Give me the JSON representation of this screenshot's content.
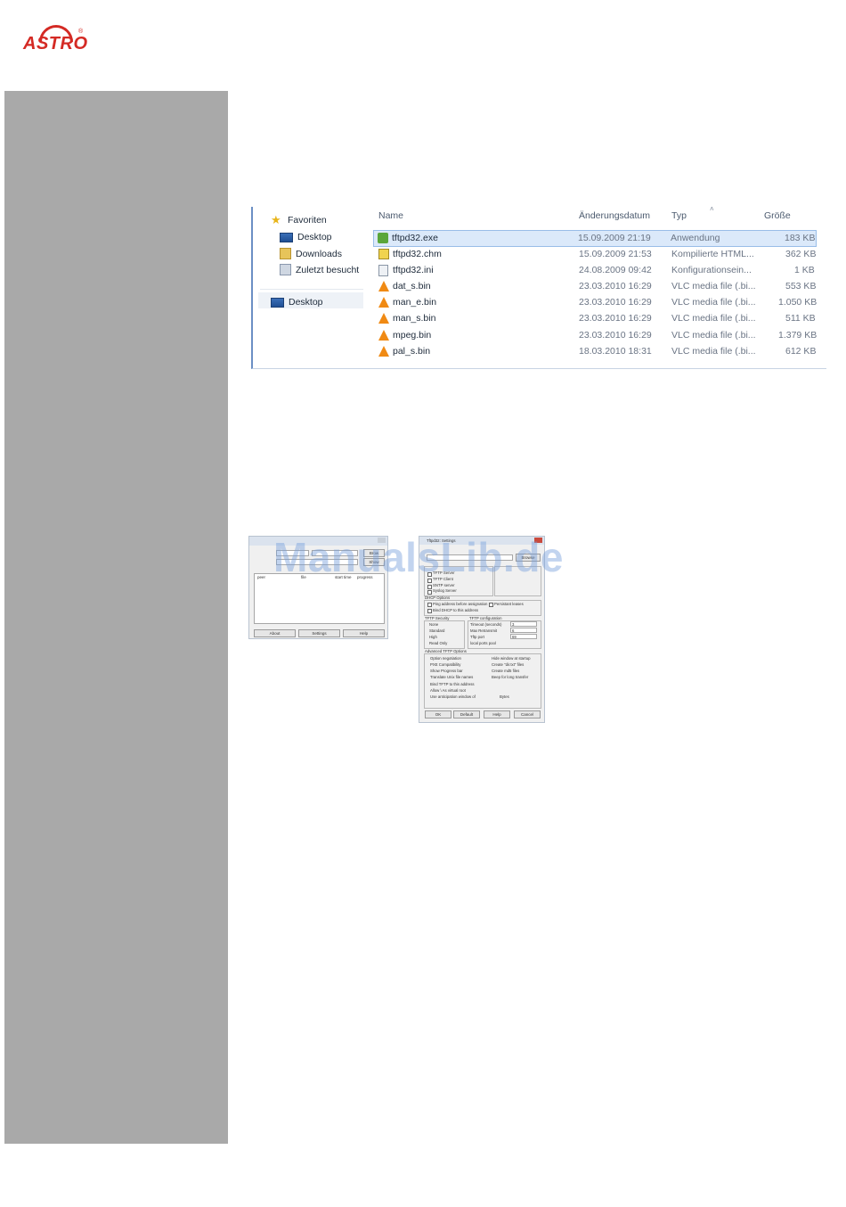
{
  "brand": {
    "logo": "ASTRO",
    "registered": "®",
    "color": "#d42a24"
  },
  "explorer": {
    "nav": [
      {
        "label": "Favoriten",
        "icon": "star-icon"
      },
      {
        "label": "Desktop",
        "icon": "desktop-icon"
      },
      {
        "label": "Downloads",
        "icon": "downloads-folder-icon"
      },
      {
        "label": "Zuletzt besucht",
        "icon": "recent-places-icon"
      },
      {
        "label": "Desktop",
        "icon": "desktop-icon"
      }
    ],
    "columns": [
      "Name",
      "Änderungsdatum",
      "Typ",
      "Größe"
    ],
    "files": [
      {
        "name": "tftpd32.exe",
        "date": "15.09.2009 21:19",
        "type": "Anwendung",
        "size": "183 KB",
        "icon": "exe-icon"
      },
      {
        "name": "tftpd32.chm",
        "date": "15.09.2009 21:53",
        "type": "Kompilierte HTML...",
        "size": "362 KB",
        "icon": "chm-icon"
      },
      {
        "name": "tftpd32.ini",
        "date": "24.08.2009 09:42",
        "type": "Konfigurationsein...",
        "size": "1 KB",
        "icon": "ini-icon"
      },
      {
        "name": "dat_s.bin",
        "date": "23.03.2010 16:29",
        "type": "VLC media file (.bi...",
        "size": "553 KB",
        "icon": "vlc-icon"
      },
      {
        "name": "man_e.bin",
        "date": "23.03.2010 16:29",
        "type": "VLC media file (.bi...",
        "size": "1.050 KB",
        "icon": "vlc-icon"
      },
      {
        "name": "man_s.bin",
        "date": "23.03.2010 16:29",
        "type": "VLC media file (.bi...",
        "size": "511 KB",
        "icon": "vlc-icon"
      },
      {
        "name": "mpeg.bin",
        "date": "23.03.2010 16:29",
        "type": "VLC media file (.bi...",
        "size": "1.379 KB",
        "icon": "vlc-icon"
      },
      {
        "name": "pal_s.bin",
        "date": "18.03.2010 18:31",
        "type": "VLC media file (.bi...",
        "size": "612 KB",
        "icon": "vlc-icon"
      }
    ]
  },
  "tftp_main": {
    "buttons": [
      "About",
      "Settings",
      "Help"
    ],
    "top_buttons": [
      "Brow",
      "Show"
    ],
    "list_columns": [
      "peer",
      "file",
      "start time",
      "progress"
    ]
  },
  "tftp_settings": {
    "title": "Tftpd32: Settings",
    "browse": "Browse",
    "groups": [
      "DHCP Options",
      "TFTP Security",
      "TFTP configuration",
      "Advanced TFTP Options"
    ],
    "services": [
      "TFTP Server",
      "TFTP Client",
      "SNTP server",
      "Syslog Server"
    ],
    "dhcp_options": [
      "Ping address before assignation",
      "Persistant leases",
      "Bind DHCP to this address"
    ],
    "security": [
      "None",
      "Standard",
      "High",
      "Read Only"
    ],
    "config": [
      "Timeout (seconds)",
      "Max Retransmit",
      "Tftp port",
      "local ports pool"
    ],
    "config_values": [
      "3",
      "6",
      "69"
    ],
    "advanced": [
      "Option negotiation",
      "Hide window at startup",
      "PXE Compatibility",
      "Create \"dir.txt\" files",
      "Show Progress bar",
      "Create md5 files",
      "Translate Unix file names",
      "Beep for long transfer",
      "Bind TFTP to this address",
      "Allow \\ As virtual root",
      "Use anticipation window of"
    ],
    "bytes": "Bytes",
    "buttons": [
      "OK",
      "Default",
      "Help",
      "Cancel"
    ]
  },
  "watermark": "ManualsLib.de"
}
